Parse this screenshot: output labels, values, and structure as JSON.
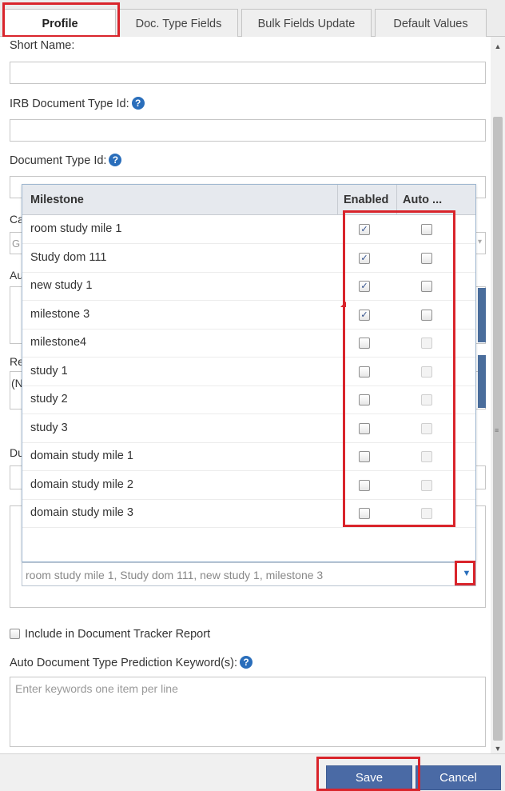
{
  "tabs": [
    {
      "label": "Profile",
      "active": true
    },
    {
      "label": "Doc. Type Fields",
      "active": false
    },
    {
      "label": "Bulk Fields Update",
      "active": false
    },
    {
      "label": "Default Values",
      "active": false
    }
  ],
  "form": {
    "short_name_label": "Short Name:",
    "irb_label": "IRB Document Type Id:",
    "doc_type_label": "Document Type Id:",
    "help_glyph": "?",
    "partial_ca": "Ca",
    "partial_g": "G",
    "partial_au": "Au",
    "partial_re": "Re",
    "partial_n": "(N",
    "partial_du": "Du"
  },
  "milestones": {
    "header_name": "Milestone",
    "header_enabled": "Enabled",
    "header_auto": "Auto ...",
    "rows": [
      {
        "name": "room study mile 1",
        "enabled": true,
        "auto": false,
        "auto_disabled": false
      },
      {
        "name": "Study dom 111",
        "enabled": true,
        "auto": false,
        "auto_disabled": false
      },
      {
        "name": "new study 1",
        "enabled": true,
        "auto": false,
        "auto_disabled": false
      },
      {
        "name": "milestone 3",
        "enabled": true,
        "auto": false,
        "auto_disabled": false
      },
      {
        "name": "milestone4",
        "enabled": false,
        "auto": false,
        "auto_disabled": true
      },
      {
        "name": "study 1",
        "enabled": false,
        "auto": false,
        "auto_disabled": true
      },
      {
        "name": "study 2",
        "enabled": false,
        "auto": false,
        "auto_disabled": true
      },
      {
        "name": "study 3",
        "enabled": false,
        "auto": false,
        "auto_disabled": true
      },
      {
        "name": "domain study mile 1",
        "enabled": false,
        "auto": false,
        "auto_disabled": true
      },
      {
        "name": "domain study mile 2",
        "enabled": false,
        "auto": false,
        "auto_disabled": true
      },
      {
        "name": "domain study mile 3",
        "enabled": false,
        "auto": false,
        "auto_disabled": true
      }
    ],
    "selected_text": "room study mile 1, Study dom 111, new study 1, milestone 3"
  },
  "include_tracker": {
    "label": "Include in Document Tracker Report",
    "checked": false
  },
  "keywords": {
    "label": "Auto Document Type Prediction Keyword(s):",
    "placeholder": "Enter keywords one item per line"
  },
  "footer": {
    "save_label": "Save",
    "cancel_label": "Cancel"
  },
  "colors": {
    "highlight": "#d9242b",
    "button": "#4a6aa5",
    "help": "#2a6ebb"
  }
}
